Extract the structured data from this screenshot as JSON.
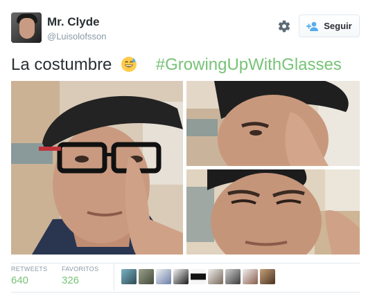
{
  "user": {
    "name": "Mr. Clyde",
    "handle": "@Luisolofsson"
  },
  "actions": {
    "follow_label": "Seguir"
  },
  "tweet": {
    "text": "La costumbre",
    "emoji": "grinning-sweat-emoji",
    "hashtag": "#GrowingUpWithGlasses"
  },
  "stats": {
    "retweets_label": "RETWEETS",
    "retweets_value": "640",
    "favorites_label": "FAVORITOS",
    "favorites_value": "326"
  },
  "icons": [
    "gear-icon",
    "follow-person-icon"
  ],
  "colors": {
    "hashtag": "#77c277",
    "stat_value": "#77c277",
    "muted": "#8899a6",
    "border": "#e1e8ed"
  }
}
